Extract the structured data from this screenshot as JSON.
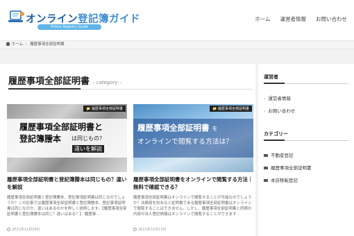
{
  "header": {
    "logo_title": "オンライン登記簿ガイド",
    "logo_title_a": "オンライン",
    "logo_title_b": "登記簿ガイド",
    "logo_subtitle": "Online Registry Guide",
    "nav": [
      "ホーム",
      "運営者情報",
      "お問い合わせ"
    ]
  },
  "breadcrumb": {
    "home": "ホーム",
    "current": "履歴事項全部証明書"
  },
  "main": {
    "title": "履歴事項全部証明書",
    "title_suffix": "– category –",
    "cards": [
      {
        "category_tag": "履歴事項全部証明書",
        "thumb_line1": "履歴事項全部証明書と",
        "thumb_line2": "登記簿謄本",
        "thumb_line3": "は同じもの？",
        "thumb_line4": "違いを解説",
        "title": "履歴事項全部証明書と登記簿謄本は同じもの？違いを解説",
        "excerpt": "履歴事項全部証明書と登記簿謄本、登記事項証明書は同じなのでしょうか？この記事では履歴事項全部証明書と登記簿謄本、登記事項証明書は同じなのか、違いはあるのかを詳しく説明します。【履歴事項全部証明書と登記簿謄本は同じ？違いはある？】 履歴事...",
        "date": "2021年11月29日"
      },
      {
        "category_tag": "履歴事項全部証明書",
        "thumb_line1": "履歴事項全部証明書",
        "thumb_line1b": "を",
        "thumb_line2": "オンラインで閲覧する方法は？",
        "title": "履歴事項全部証明書をオンラインで閲覧する方法｜無料で確認できる？",
        "excerpt": "履歴事項全部証明書はオンラインで閲覧することが可能なのでしょうか？法務局を訪ねると証明書である履歴事項全部証明書はオンラインで閲覧することはできません。しかし、履歴事項全部証明書と同様の内容の法人登記情報はオンラインで閲覧することができます...",
        "date": "2021年10月13日"
      }
    ]
  },
  "sidebar": {
    "operator_title": "運営者",
    "operator_links": [
      "運営者情報",
      "お問い合わせ"
    ],
    "category_title": "カテゴリー",
    "categories": [
      "不動産登記",
      "履歴事項全部証明書",
      "本店移転登記"
    ]
  },
  "colors": {
    "brand_blue": "#2a6fb5",
    "accent_sky": "#5fb5e6",
    "tag_bg": "#222222"
  }
}
